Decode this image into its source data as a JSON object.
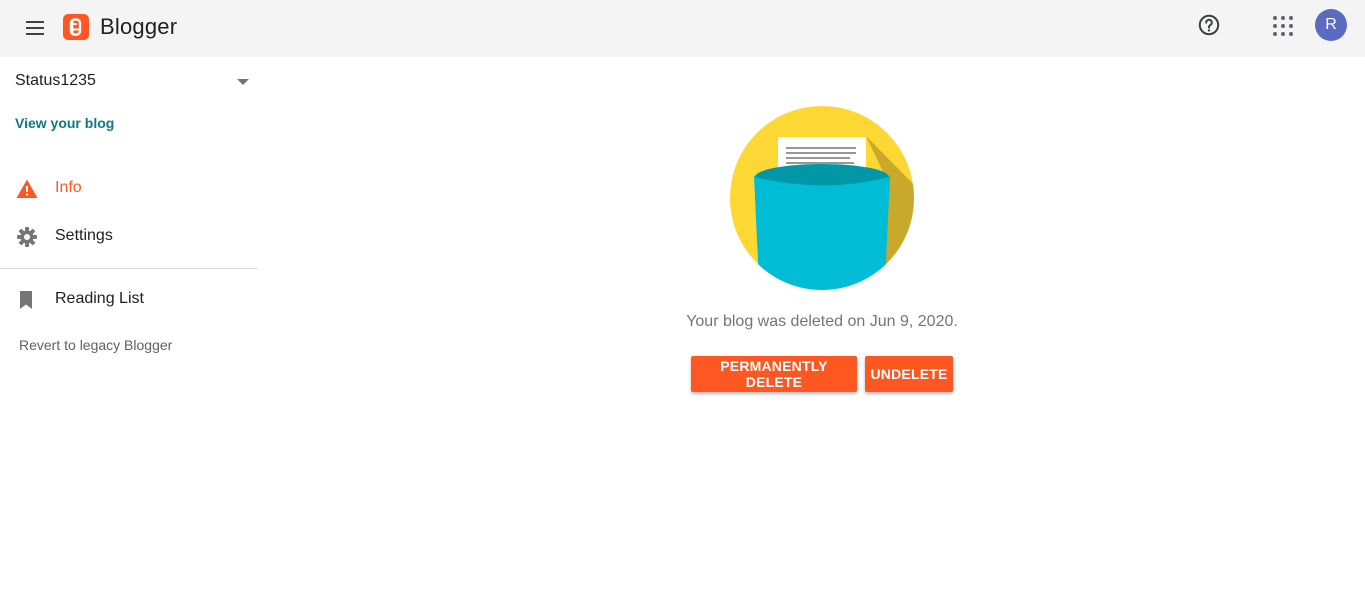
{
  "header": {
    "app_name": "Blogger",
    "avatar_initial": "R",
    "brand_color": "#ff5722",
    "icons": [
      "menu-icon",
      "blogger-logo-icon",
      "help-icon",
      "apps-grid-icon"
    ]
  },
  "sidebar": {
    "blog_name": "Status1235",
    "view_blog": "View your blog",
    "items": [
      {
        "label": "Info",
        "icon": "warning-icon",
        "active": true
      },
      {
        "label": "Settings",
        "icon": "gear-icon",
        "active": false
      },
      {
        "label": "Reading List",
        "icon": "bookmark-icon",
        "active": false
      }
    ],
    "legacy_link": "Revert to legacy Blogger"
  },
  "main": {
    "message": "Your blog was deleted on Jun 9, 2020.",
    "buttons": {
      "permanently_delete": "PERMANENTLY DELETE",
      "undelete": "UNDELETE"
    },
    "illustration": "document-in-bin-illustration"
  }
}
